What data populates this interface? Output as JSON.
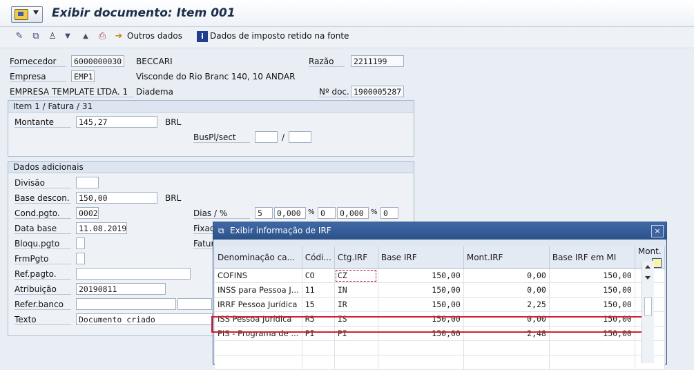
{
  "header": {
    "title": "Exibir documento: Item 001"
  },
  "toolbar": {
    "outros_dados": "Outros dados",
    "dados_imposto": "Dados de imposto retido na fonte"
  },
  "form": {
    "fornecedor_label": "Fornecedor",
    "fornecedor_value": "6000000030",
    "fornecedor_name": "BECCARI",
    "razao_label": "Razão",
    "razao_value": "2211199",
    "empresa_label": "Empresa",
    "empresa_value": "EMP1",
    "address": "Visconde do Rio Branc 140, 10 ANDAR",
    "company_name": "EMPRESA TEMPLATE LTDA. 1",
    "city": "Diadema",
    "ndoc_label": "Nº doc.",
    "ndoc_value": "1900005287"
  },
  "item_group": {
    "title": "Item 1 / Fatura / 31",
    "montante_label": "Montante",
    "montante_value": "145,27",
    "currency": "BRL",
    "buspl_label": "BusPl/sect",
    "slash": "/"
  },
  "dados_group": {
    "title": "Dados adicionais",
    "divisao_label": "Divisão",
    "base_descon_label": "Base descon.",
    "base_descon_value": "150,00",
    "currency": "BRL",
    "cond_pgto_label": "Cond.pgto.",
    "cond_pgto_value": "0002",
    "dias_label": "Dias / %",
    "dias1": "5",
    "pct1": "0,000",
    "pct_sign": "%",
    "dias2": "0",
    "pct2": "0,000",
    "dias3": "0",
    "data_base_label": "Data base",
    "data_base_value": "11.08.2019",
    "fixad_label": "Fixad",
    "bloqu_label": "Bloqu.pgto",
    "fatur_label": "Fatur",
    "frmpgto_label": "FrmPgto",
    "refpagto_label": "Ref.pagto.",
    "atribuicao_label": "Atribuição",
    "atribuicao_value": "20190811",
    "referbanco_label": "Refer.banco",
    "texto_label": "Texto",
    "texto_value": "Documento criado"
  },
  "popup": {
    "title": "Exibir informação de IRF",
    "close": "×",
    "columns": [
      "Denominação ca...",
      "Códi...",
      "Ctg.IRF",
      "Base IRF",
      "Mont.IRF",
      "Base IRF em MI",
      "Mont."
    ],
    "rows": [
      [
        "COFINS",
        "CO",
        "CZ",
        "150,00",
        "0,00",
        "150,00",
        ""
      ],
      [
        "INSS para Pessoa J...",
        "11",
        "IN",
        "150,00",
        "0,00",
        "150,00",
        ""
      ],
      [
        "IRRF Pessoa Jurídica",
        "15",
        "IR",
        "150,00",
        "2,25",
        "150,00",
        ""
      ],
      [
        "ISS  Pessoa Jurídica",
        "R5",
        "IS",
        "150,00",
        "0,00",
        "150,00",
        ""
      ],
      [
        "PIS - Programa de ...",
        "PI",
        "PI",
        "150,00",
        "2,48",
        "150,00",
        ""
      ]
    ]
  }
}
